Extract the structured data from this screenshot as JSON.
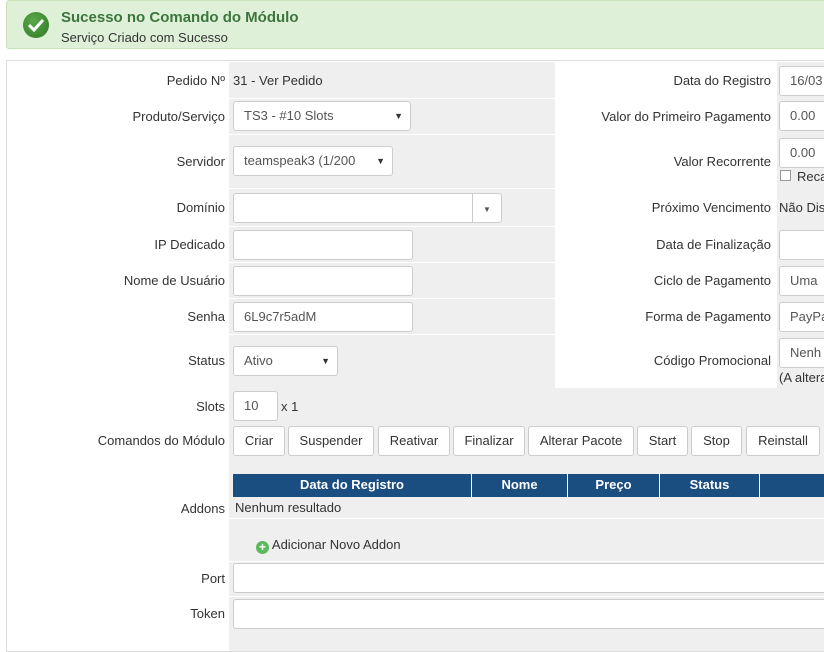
{
  "alert": {
    "title": "Sucesso no Comando do Módulo",
    "message": "Serviço Criado com Sucesso"
  },
  "left": {
    "pedido_label": "Pedido Nº",
    "pedido_value": "31 - Ver Pedido",
    "produto_label": "Produto/Serviço",
    "produto_value": "TS3 - #10 Slots",
    "servidor_label": "Servidor",
    "servidor_value": "teamspeak3 (1/200",
    "dominio_label": "Domínio",
    "dominio_value": "",
    "ip_label": "IP Dedicado",
    "ip_value": "",
    "usuario_label": "Nome de Usuário",
    "usuario_value": "",
    "senha_label": "Senha",
    "senha_value": "6L9c7r5adM",
    "status_label": "Status",
    "status_value": "Ativo",
    "slots_label": "Slots",
    "slots_value": "10",
    "slots_mult": "x 1",
    "comandos_label": "Comandos do Módulo"
  },
  "right": {
    "data_registro_label": "Data do Registro",
    "data_registro_value": "16/03",
    "primeiro_pag_label": "Valor do Primeiro Pagamento",
    "primeiro_pag_value": "0.00",
    "recorrente_label": "Valor Recorrente",
    "recorrente_value": "0.00",
    "recalc_label": "Reca",
    "proximo_label": "Próximo Vencimento",
    "proximo_value": "Não Dis",
    "finalizacao_label": "Data de Finalização",
    "finalizacao_value": "",
    "ciclo_label": "Ciclo de Pagamento",
    "ciclo_value": "Uma",
    "forma_label": "Forma de Pagamento",
    "forma_value": "PayPa",
    "promo_label": "Código Promocional",
    "promo_value": "Nenh",
    "promo_note": "(A altera"
  },
  "commands": [
    "Criar",
    "Suspender",
    "Reativar",
    "Finalizar",
    "Alterar Pacote",
    "Start",
    "Stop",
    "Reinstall"
  ],
  "addons": {
    "label": "Addons",
    "columns": [
      "Data do Registro",
      "Nome",
      "Preço",
      "Status"
    ],
    "empty": "Nenhum resultado",
    "add_label": "Adicionar Novo Addon"
  },
  "port_label": "Port",
  "port_value": "",
  "token_label": "Token",
  "token_value": "",
  "colors": {
    "header_blue": "#1a4d80",
    "success_green": "#3c763d"
  }
}
